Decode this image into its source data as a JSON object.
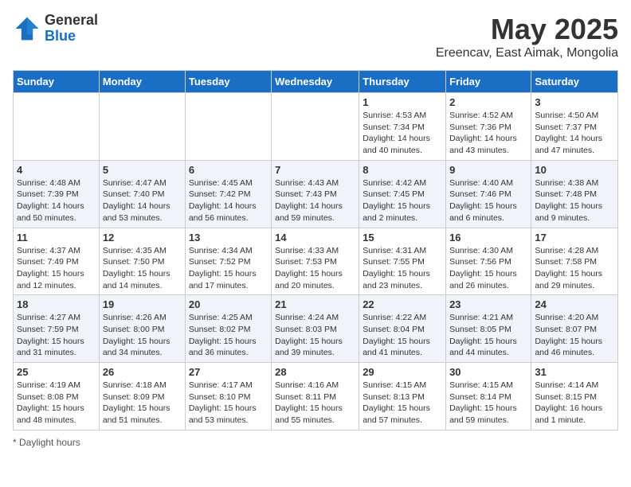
{
  "header": {
    "logo_general": "General",
    "logo_blue": "Blue",
    "month_title": "May 2025",
    "subtitle": "Ereencav, East Aimak, Mongolia"
  },
  "days_of_week": [
    "Sunday",
    "Monday",
    "Tuesday",
    "Wednesday",
    "Thursday",
    "Friday",
    "Saturday"
  ],
  "weeks": [
    [
      {
        "day": "",
        "info": ""
      },
      {
        "day": "",
        "info": ""
      },
      {
        "day": "",
        "info": ""
      },
      {
        "day": "",
        "info": ""
      },
      {
        "day": "1",
        "info": "Sunrise: 4:53 AM\nSunset: 7:34 PM\nDaylight: 14 hours and 40 minutes."
      },
      {
        "day": "2",
        "info": "Sunrise: 4:52 AM\nSunset: 7:36 PM\nDaylight: 14 hours and 43 minutes."
      },
      {
        "day": "3",
        "info": "Sunrise: 4:50 AM\nSunset: 7:37 PM\nDaylight: 14 hours and 47 minutes."
      }
    ],
    [
      {
        "day": "4",
        "info": "Sunrise: 4:48 AM\nSunset: 7:39 PM\nDaylight: 14 hours and 50 minutes."
      },
      {
        "day": "5",
        "info": "Sunrise: 4:47 AM\nSunset: 7:40 PM\nDaylight: 14 hours and 53 minutes."
      },
      {
        "day": "6",
        "info": "Sunrise: 4:45 AM\nSunset: 7:42 PM\nDaylight: 14 hours and 56 minutes."
      },
      {
        "day": "7",
        "info": "Sunrise: 4:43 AM\nSunset: 7:43 PM\nDaylight: 14 hours and 59 minutes."
      },
      {
        "day": "8",
        "info": "Sunrise: 4:42 AM\nSunset: 7:45 PM\nDaylight: 15 hours and 2 minutes."
      },
      {
        "day": "9",
        "info": "Sunrise: 4:40 AM\nSunset: 7:46 PM\nDaylight: 15 hours and 6 minutes."
      },
      {
        "day": "10",
        "info": "Sunrise: 4:38 AM\nSunset: 7:48 PM\nDaylight: 15 hours and 9 minutes."
      }
    ],
    [
      {
        "day": "11",
        "info": "Sunrise: 4:37 AM\nSunset: 7:49 PM\nDaylight: 15 hours and 12 minutes."
      },
      {
        "day": "12",
        "info": "Sunrise: 4:35 AM\nSunset: 7:50 PM\nDaylight: 15 hours and 14 minutes."
      },
      {
        "day": "13",
        "info": "Sunrise: 4:34 AM\nSunset: 7:52 PM\nDaylight: 15 hours and 17 minutes."
      },
      {
        "day": "14",
        "info": "Sunrise: 4:33 AM\nSunset: 7:53 PM\nDaylight: 15 hours and 20 minutes."
      },
      {
        "day": "15",
        "info": "Sunrise: 4:31 AM\nSunset: 7:55 PM\nDaylight: 15 hours and 23 minutes."
      },
      {
        "day": "16",
        "info": "Sunrise: 4:30 AM\nSunset: 7:56 PM\nDaylight: 15 hours and 26 minutes."
      },
      {
        "day": "17",
        "info": "Sunrise: 4:28 AM\nSunset: 7:58 PM\nDaylight: 15 hours and 29 minutes."
      }
    ],
    [
      {
        "day": "18",
        "info": "Sunrise: 4:27 AM\nSunset: 7:59 PM\nDaylight: 15 hours and 31 minutes."
      },
      {
        "day": "19",
        "info": "Sunrise: 4:26 AM\nSunset: 8:00 PM\nDaylight: 15 hours and 34 minutes."
      },
      {
        "day": "20",
        "info": "Sunrise: 4:25 AM\nSunset: 8:02 PM\nDaylight: 15 hours and 36 minutes."
      },
      {
        "day": "21",
        "info": "Sunrise: 4:24 AM\nSunset: 8:03 PM\nDaylight: 15 hours and 39 minutes."
      },
      {
        "day": "22",
        "info": "Sunrise: 4:22 AM\nSunset: 8:04 PM\nDaylight: 15 hours and 41 minutes."
      },
      {
        "day": "23",
        "info": "Sunrise: 4:21 AM\nSunset: 8:05 PM\nDaylight: 15 hours and 44 minutes."
      },
      {
        "day": "24",
        "info": "Sunrise: 4:20 AM\nSunset: 8:07 PM\nDaylight: 15 hours and 46 minutes."
      }
    ],
    [
      {
        "day": "25",
        "info": "Sunrise: 4:19 AM\nSunset: 8:08 PM\nDaylight: 15 hours and 48 minutes."
      },
      {
        "day": "26",
        "info": "Sunrise: 4:18 AM\nSunset: 8:09 PM\nDaylight: 15 hours and 51 minutes."
      },
      {
        "day": "27",
        "info": "Sunrise: 4:17 AM\nSunset: 8:10 PM\nDaylight: 15 hours and 53 minutes."
      },
      {
        "day": "28",
        "info": "Sunrise: 4:16 AM\nSunset: 8:11 PM\nDaylight: 15 hours and 55 minutes."
      },
      {
        "day": "29",
        "info": "Sunrise: 4:15 AM\nSunset: 8:13 PM\nDaylight: 15 hours and 57 minutes."
      },
      {
        "day": "30",
        "info": "Sunrise: 4:15 AM\nSunset: 8:14 PM\nDaylight: 15 hours and 59 minutes."
      },
      {
        "day": "31",
        "info": "Sunrise: 4:14 AM\nSunset: 8:15 PM\nDaylight: 16 hours and 1 minute."
      }
    ]
  ],
  "footer": {
    "note": "Daylight hours"
  }
}
